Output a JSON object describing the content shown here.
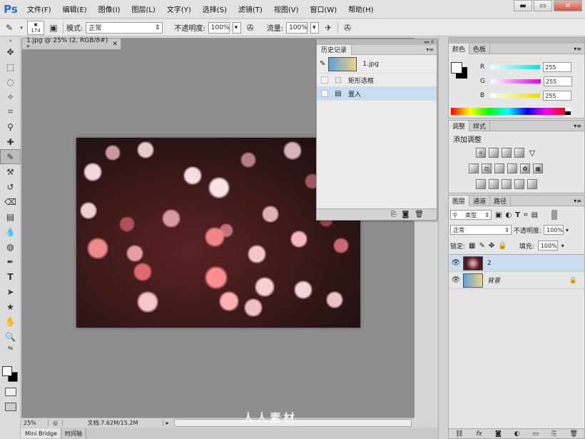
{
  "app": {
    "logo": "Ps"
  },
  "menu": [
    "文件(F)",
    "编辑(E)",
    "图像(I)",
    "图层(L)",
    "文字(Y)",
    "选择(S)",
    "滤镜(T)",
    "视图(V)",
    "窗口(W)",
    "帮助(H)"
  ],
  "window_controls": {
    "minimize": "▬",
    "restore": "▭",
    "close": "✕"
  },
  "options": {
    "brush_size": "174",
    "mode_label": "模式:",
    "mode_value": "正常",
    "opacity_label": "不透明度:",
    "opacity_value": "100%",
    "flow_label": "流量:",
    "flow_value": "100%"
  },
  "document": {
    "tab_title": "1.jpg @ 25% (2, RGB/8#) *",
    "zoom": "25%",
    "doc_info": "文档:7.62M/15.2M"
  },
  "bottom_tabs": [
    "Mini Bridge",
    "时间轴"
  ],
  "history": {
    "tab": "历史记录",
    "snapshot": "1.jpg",
    "items": [
      "矩形选框",
      "置入"
    ]
  },
  "color_panel": {
    "tabs": [
      "颜色",
      "色板"
    ],
    "channels": [
      {
        "name": "R",
        "value": "255",
        "color": "#00e0e0"
      },
      {
        "name": "G",
        "value": "255",
        "color": "#e000e0"
      },
      {
        "name": "B",
        "value": "255",
        "color": "#e0e000"
      }
    ]
  },
  "adjust_panel": {
    "tabs": [
      "调整",
      "样式"
    ],
    "title": "添加调整"
  },
  "layers_panel": {
    "tabs": [
      "图层",
      "通道",
      "路径"
    ],
    "filter_type": "类型",
    "blend_mode": "正常",
    "opacity_label": "不透明度:",
    "opacity_value": "100%",
    "lock_label": "锁定:",
    "fill_label": "填充:",
    "fill_value": "100%",
    "layers": [
      {
        "name": "2",
        "selected": true
      },
      {
        "name": "背景",
        "selected": false
      }
    ]
  },
  "watermark": "人人素材"
}
